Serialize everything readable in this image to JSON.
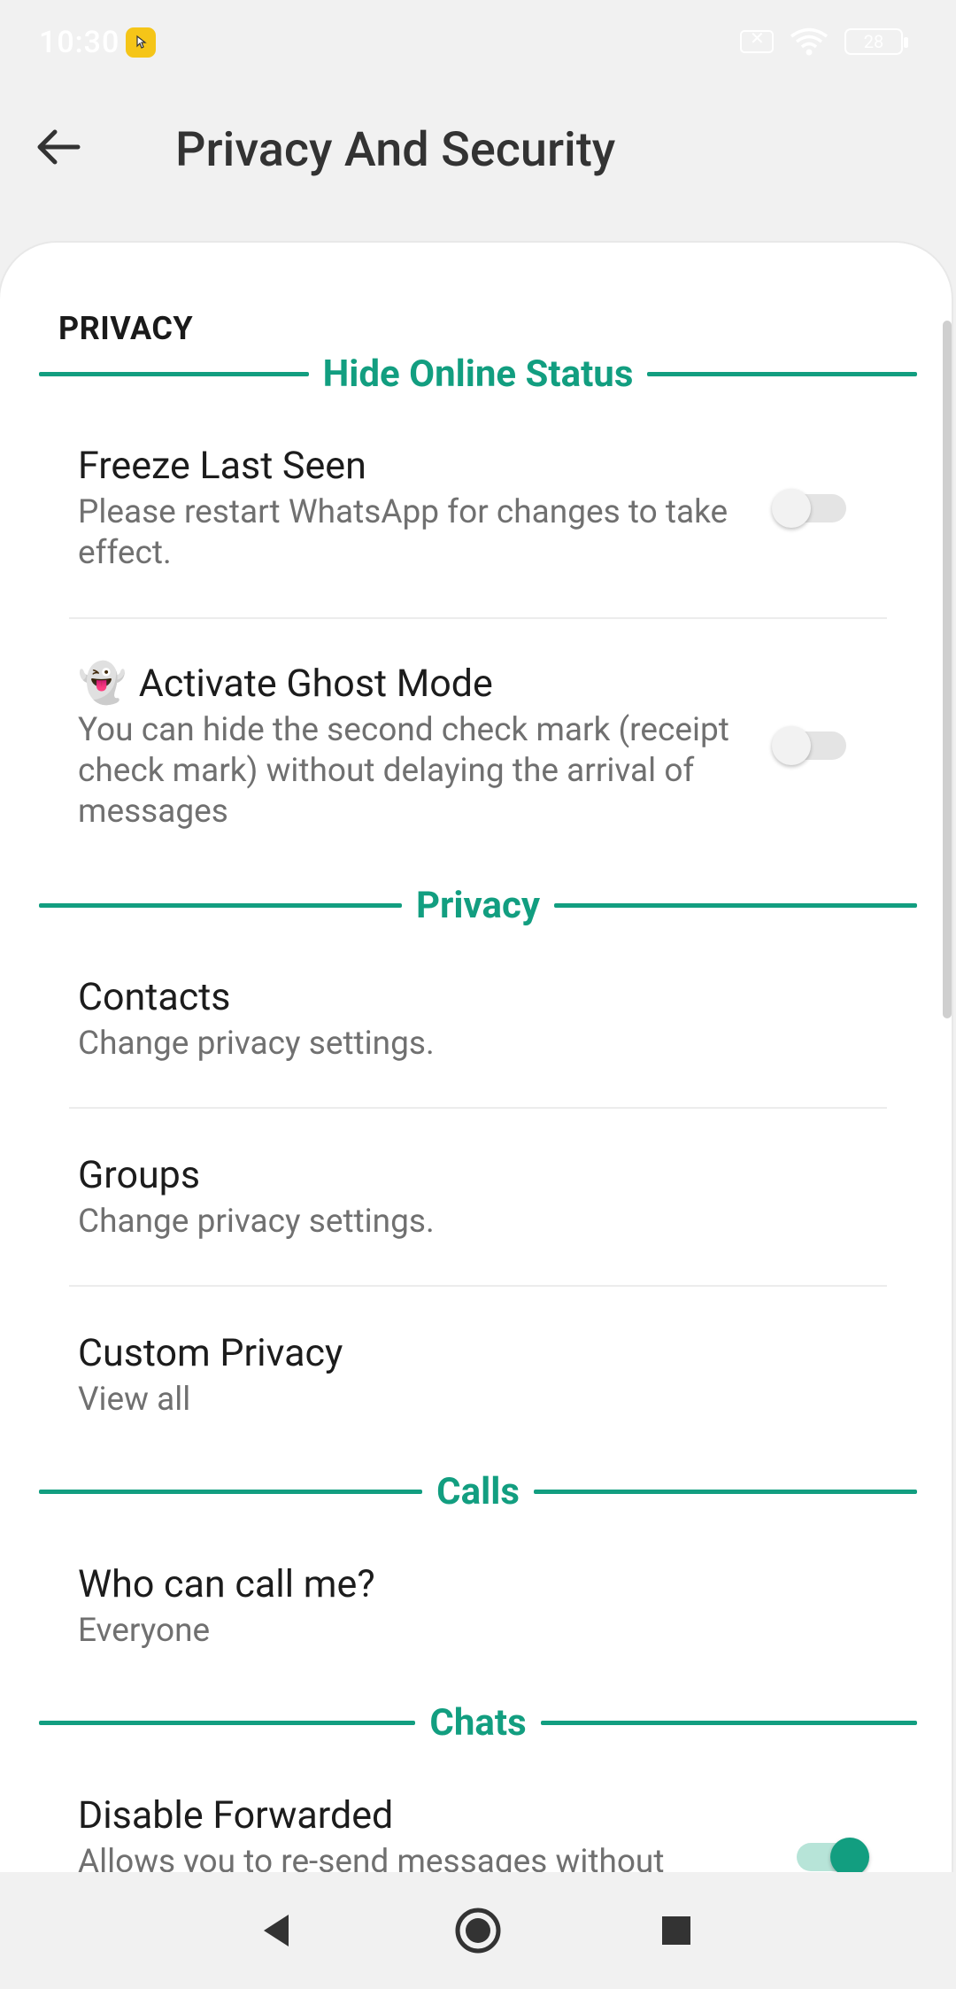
{
  "status_bar": {
    "time": "10:30",
    "battery": "28",
    "icons": [
      "sim-off-icon",
      "wifi-icon",
      "battery-icon"
    ]
  },
  "app_bar": {
    "title": "Privacy And Security",
    "back_icon": "arrow-left-icon"
  },
  "section": {
    "header": "PRIVACY"
  },
  "groups": {
    "hide_online": "Hide Online Status",
    "privacy": "Privacy",
    "calls": "Calls",
    "chats": "Chats"
  },
  "settings": {
    "freeze_last_seen": {
      "title": "Freeze Last Seen",
      "subtitle": "Please restart WhatsApp for changes to take effect.",
      "enabled": false
    },
    "ghost_mode": {
      "emoji": "👻",
      "title": "Activate Ghost Mode",
      "subtitle": "You can hide the second check mark (receipt check mark) without delaying the arrival of messages",
      "enabled": false
    },
    "contacts": {
      "title": "Contacts",
      "subtitle": "Change privacy settings."
    },
    "groups": {
      "title": "Groups",
      "subtitle": "Change privacy settings."
    },
    "custom_privacy": {
      "title": "Custom Privacy",
      "subtitle": "View all"
    },
    "who_can_call": {
      "title": "Who can call me?",
      "subtitle": "Everyone"
    },
    "disable_forwarded": {
      "title": "Disable Forwarded",
      "subtitle": "Allows you to re-send messages without",
      "enabled": true
    }
  },
  "colors": {
    "accent": "#129e80",
    "background": "#f1f1f1",
    "card": "#ffffff"
  },
  "nav_bar": {
    "icons": [
      "back-triangle-icon",
      "home-circle-icon",
      "recents-square-icon"
    ]
  }
}
